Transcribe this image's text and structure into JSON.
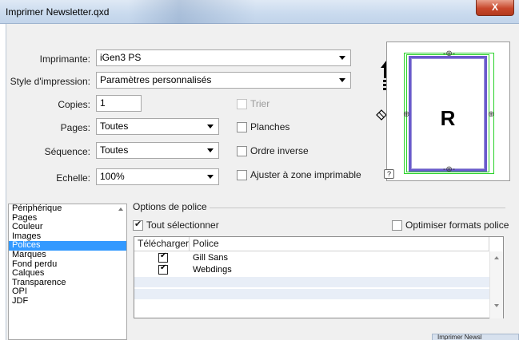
{
  "window": {
    "title": "Imprimer Newsletter.qxd",
    "close_label": "X"
  },
  "form": {
    "printer_label": "Imprimante:",
    "printer_value": "iGen3 PS",
    "style_label": "Style d'impression:",
    "style_value": "Paramètres personnalisés",
    "copies_label": "Copies:",
    "copies_value": "1",
    "pages_label": "Pages:",
    "pages_value": "Toutes",
    "sequence_label": "Séquence:",
    "sequence_value": "Toutes",
    "scale_label": "Echelle:",
    "scale_value": "100%",
    "checkboxes": {
      "collate": {
        "label": "Trier",
        "checked": false,
        "enabled": false
      },
      "spreads": {
        "label": "Planches",
        "checked": false,
        "enabled": true
      },
      "reverse": {
        "label": "Ordre inverse",
        "checked": false,
        "enabled": true
      },
      "fit": {
        "label": "Ajuster à zone imprimable",
        "checked": false,
        "enabled": true
      }
    }
  },
  "preview": {
    "letter": "R",
    "help": "?",
    "colors": {
      "page_border": "#6a5acd",
      "bleed": "#2bd22b"
    }
  },
  "categories": {
    "items": [
      "Périphérique",
      "Pages",
      "Couleur",
      "Images",
      "Polices",
      "Marques",
      "Fond perdu",
      "Calques",
      "Transparence",
      "OPI",
      "JDF"
    ],
    "selected": "Polices"
  },
  "font_options": {
    "group_title": "Options de police",
    "select_all_label": "Tout sélectionner",
    "select_all_checked": true,
    "optimize_label": "Optimiser formats police",
    "optimize_checked": false,
    "columns": [
      "Télécharger",
      "Police"
    ],
    "rows": [
      {
        "download": true,
        "font": "Gill Sans"
      },
      {
        "download": true,
        "font": "Webdings"
      }
    ]
  },
  "taskbar": {
    "label": "Imprimer Newsl"
  },
  "colors": {
    "selection": "#3399ff",
    "accent_close": "#c8482c"
  }
}
